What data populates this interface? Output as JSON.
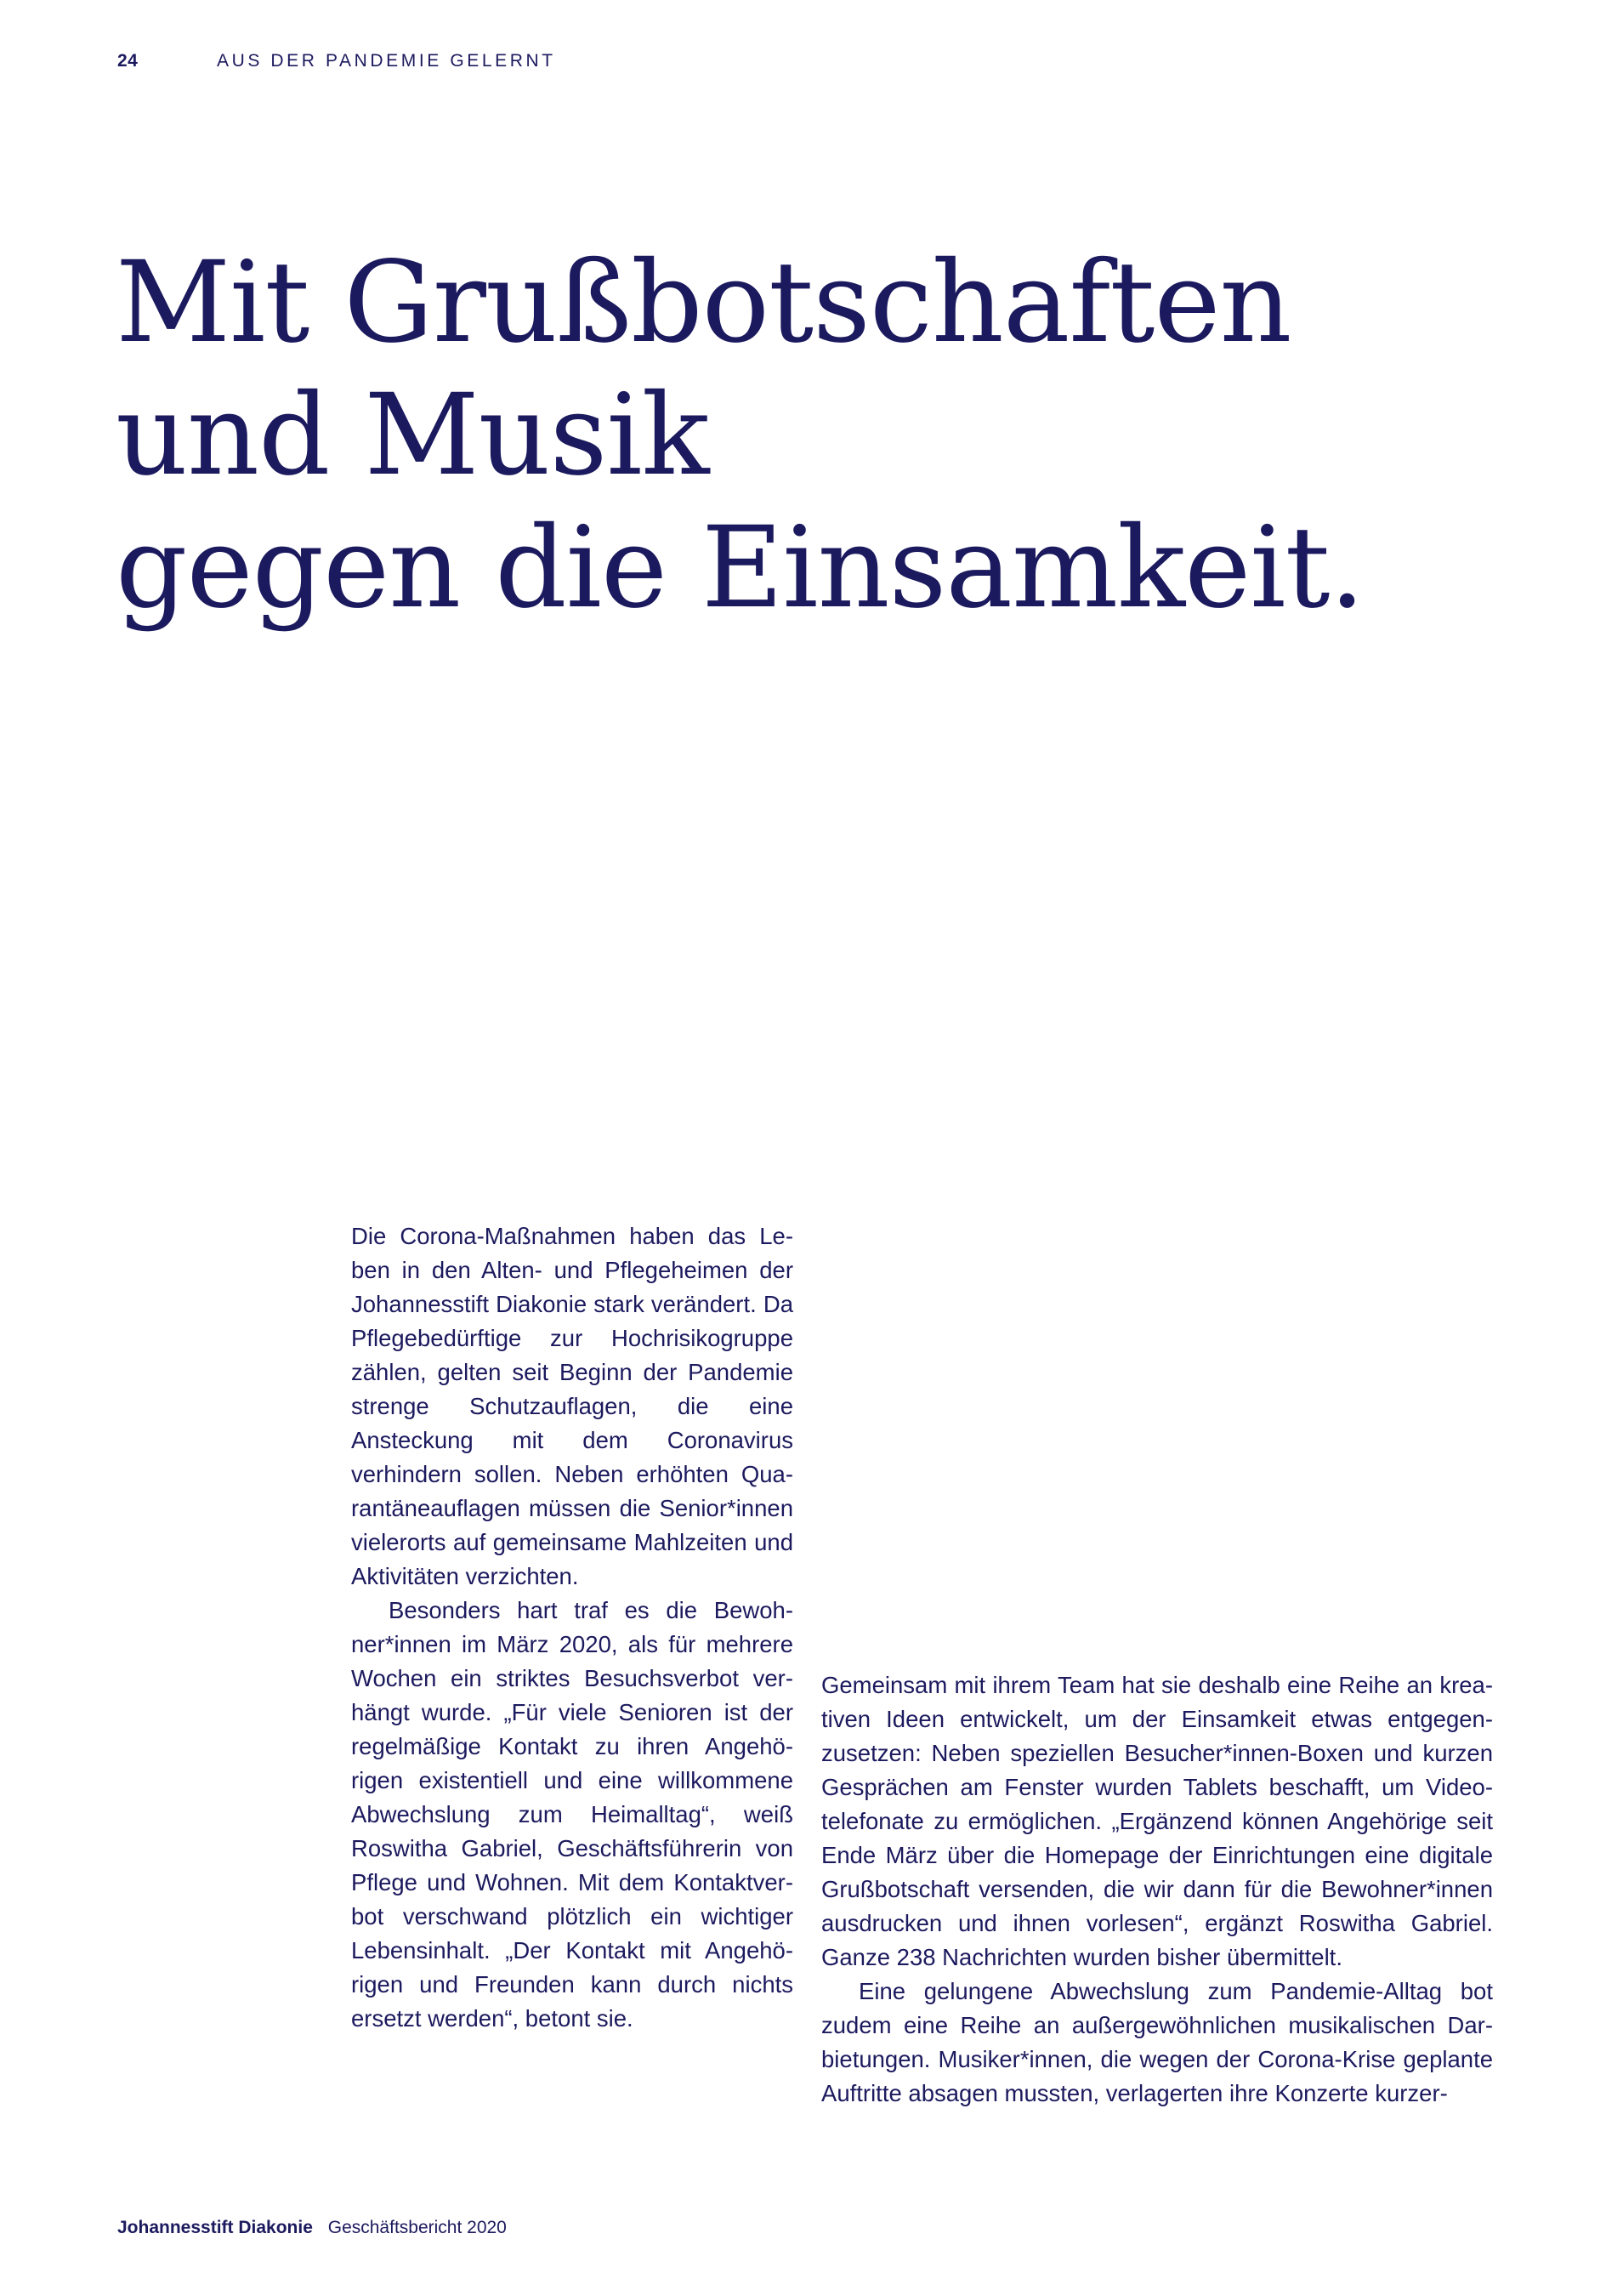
{
  "header": {
    "page_number": "24",
    "section": "AUS DER PANDEMIE GELERNT"
  },
  "headline": {
    "line1": "Mit Grußbotschaften",
    "line2": "und Musik",
    "line3": "gegen die Einsamkeit."
  },
  "body": {
    "left_column": [
      "Die Corona-Maßnahmen haben das Le­ben in den Alten- und Pflegeheimen der Johannesstift Diakonie stark verändert. Da Pflegebedürftige zur Hochrisiko­gruppe zählen, gelten seit Beginn der Pandemie strenge Schutzauflagen, die eine Ansteckung mit dem Coronavirus verhindern sollen. Neben erhöhten Qua­rantäneauflagen müssen die Senior*in­nen vielerorts auf gemeinsame Mahl­zeiten und Aktivitäten verzichten.",
      "Besonders hart traf es die Bewoh­ner*innen im März 2020, als für mehrere Wochen ein striktes Besuchsverbot ver­hängt wurde. „Für viele Senioren ist der regelmäßige Kontakt zu ihren Angehö­rigen existentiell und eine willkommene Abwechslung zum Heimalltag“, weiß Roswitha Gabriel, Geschäftsführerin von Pflege und Wohnen. Mit dem Kontaktver­bot verschwand plötzlich ein wichtiger Lebensinhalt. „Der Kontakt mit Angehö­rigen und Freunden kann durch nichts ersetzt werden“, betont sie."
    ],
    "right_column": [
      "Gemeinsam mit ihrem Team hat sie deshalb eine Reihe an krea­tiven Ideen entwickelt, um der Einsamkeit etwas entgegen­zusetzen: Neben speziellen Besucher*innen-Boxen und kurzen Gesprächen am Fenster wurden Tablets beschafft, um Video­telefonate zu ermöglichen. „Ergänzend können Angehörige seit Ende März über die Homepage der Einrichtungen eine digitale Grußbotschaft versenden, die wir dann für die Bewohner*innen ausdrucken und ihnen vorlesen“, ergänzt Roswitha Gabriel. Ganze 238 Nachrichten wurden bisher übermittelt.",
      "Eine gelungene Abwechslung zum Pandemie-Alltag bot zudem eine Reihe an außergewöhnlichen musikalischen Dar­bietungen. Musiker*innen, die wegen der Corona-Krise geplante Auftritte absagen mussten, verlagerten ihre Konzerte kurzer-"
    ]
  },
  "footer": {
    "brand": "Johannesstift Diakonie",
    "report": "Geschäftsbericht 2020"
  },
  "colors": {
    "text": "#1c1a5e",
    "background": "#ffffff"
  }
}
